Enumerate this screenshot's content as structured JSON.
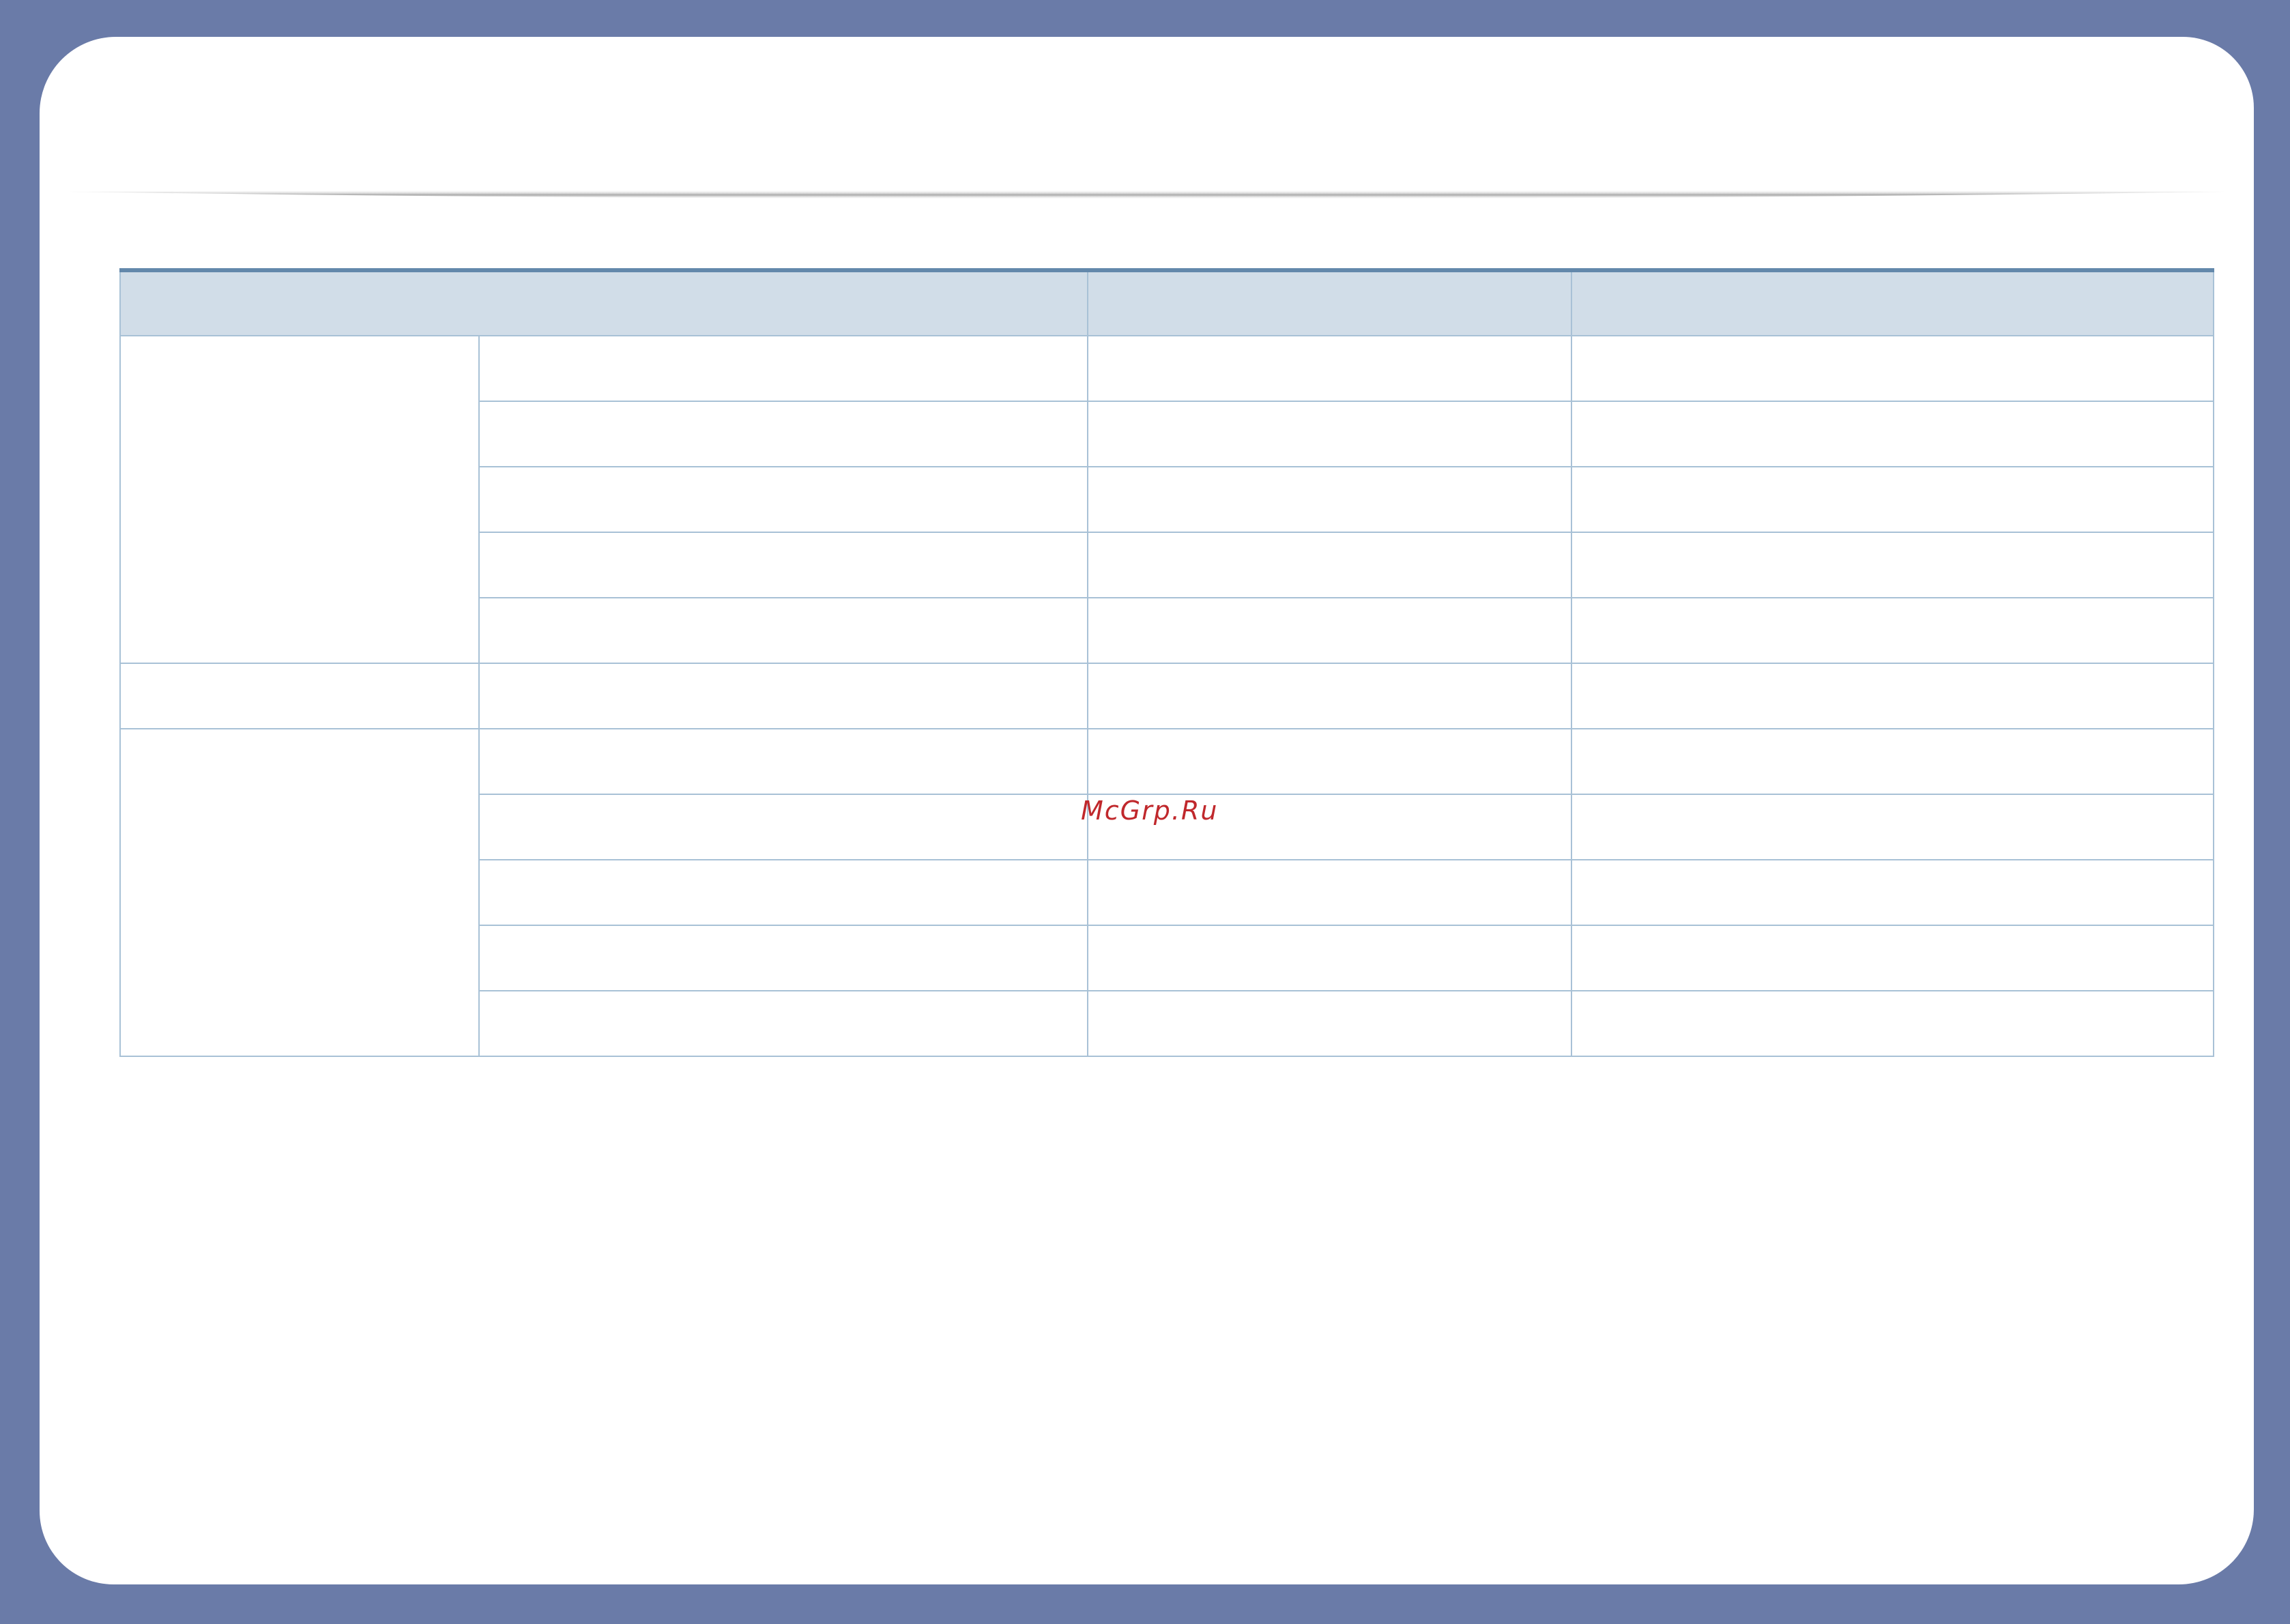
{
  "watermark": "McGrp.Ru",
  "table": {
    "header": [
      "",
      "",
      ""
    ],
    "groups": [
      {
        "label": "",
        "rows": [
          [
            "",
            "",
            ""
          ],
          [
            "",
            "",
            ""
          ],
          [
            "",
            "",
            ""
          ],
          [
            "",
            "",
            ""
          ],
          [
            "",
            "",
            ""
          ]
        ]
      },
      {
        "label": "",
        "rows": [
          [
            "",
            "",
            ""
          ]
        ]
      },
      {
        "label": "",
        "rows": [
          [
            "",
            "",
            ""
          ],
          [
            "",
            "",
            ""
          ],
          [
            "",
            "",
            ""
          ],
          [
            "",
            "",
            ""
          ],
          [
            "",
            "",
            ""
          ]
        ]
      }
    ]
  },
  "colors": {
    "frame": "#6a7ba8",
    "table_header_bg": "#d1dde8",
    "table_top_rule": "#6388ab",
    "table_grid": "#a8c1d6",
    "watermark": "#c0282c"
  }
}
